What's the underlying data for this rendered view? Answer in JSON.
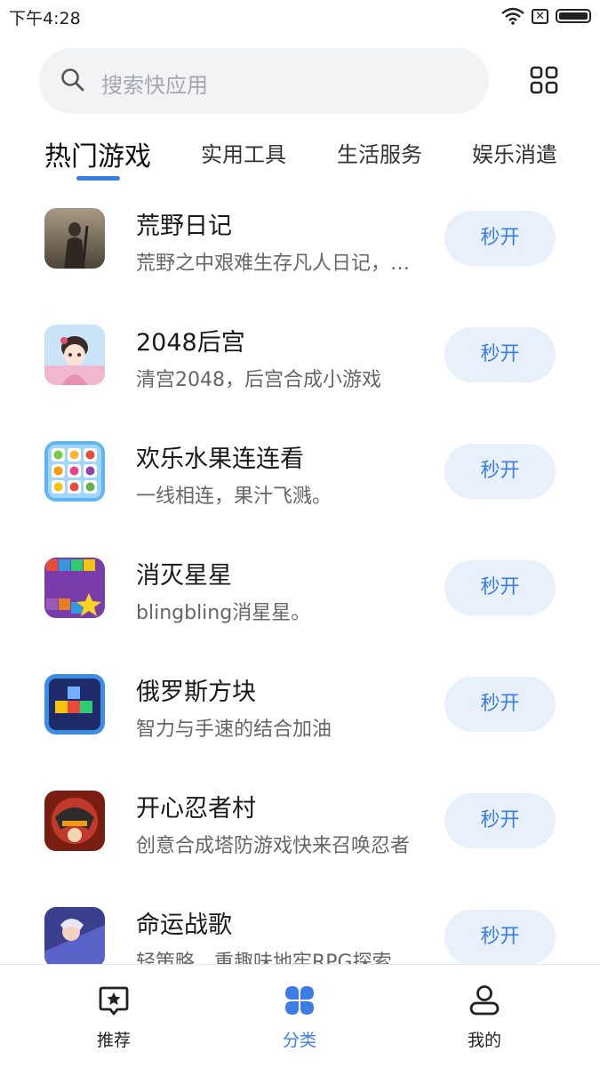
{
  "status_bar": {
    "time": "下午4:28",
    "sim_glyph": "✕"
  },
  "search": {
    "placeholder": "搜索快应用"
  },
  "tabs": [
    {
      "label": "热门游戏",
      "active": true
    },
    {
      "label": "实用工具",
      "active": false
    },
    {
      "label": "生活服务",
      "active": false
    },
    {
      "label": "娱乐消遣",
      "active": false
    }
  ],
  "games": [
    {
      "title": "荒野日记",
      "desc": "荒野之中艰难生存凡人日记，生存与建造的冒险",
      "button": "秒开",
      "icon": "wilderness-diary-icon"
    },
    {
      "title": "2048后宫",
      "desc": "清宫2048，后宫合成小游戏",
      "button": "秒开",
      "icon": "palace-2048-icon"
    },
    {
      "title": "欢乐水果连连看",
      "desc": "一线相连，果汁飞溅。",
      "button": "秒开",
      "icon": "fruit-link-icon"
    },
    {
      "title": "消灭星星",
      "desc": "blingbling消星星。",
      "button": "秒开",
      "icon": "pop-stars-icon"
    },
    {
      "title": "俄罗斯方块",
      "desc": "智力与手速的结合加油",
      "button": "秒开",
      "icon": "tetris-icon"
    },
    {
      "title": "开心忍者村",
      "desc": "创意合成塔防游戏快来召唤忍者",
      "button": "秒开",
      "icon": "ninja-village-icon"
    },
    {
      "title": "命运战歌",
      "desc": "轻策略，重趣味地牢RPG探索",
      "button": "秒开",
      "icon": "fate-war-song-icon"
    }
  ],
  "bottom_nav": [
    {
      "label": "推荐",
      "icon": "star-chat-icon",
      "active": false
    },
    {
      "label": "分类",
      "icon": "grid-petals-icon",
      "active": true
    },
    {
      "label": "我的",
      "icon": "person-icon",
      "active": false
    }
  ],
  "colors": {
    "accent": "#3b7de6",
    "button_bg": "#e8f0fb",
    "search_bg": "#f2f3f5"
  }
}
